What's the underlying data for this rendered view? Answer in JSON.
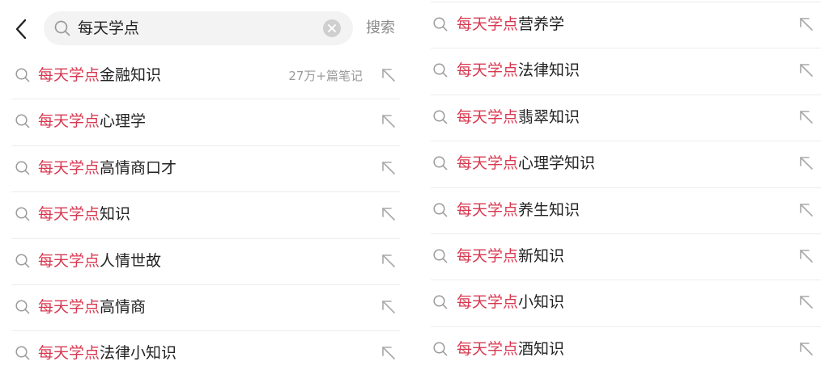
{
  "search": {
    "query": "每天学点",
    "button_label": "搜索"
  },
  "colors": {
    "highlight": "#d8374f",
    "muted": "#9a9a9a",
    "search_bg": "#f3f3f3"
  },
  "icons": {
    "back": "chevron-left-icon",
    "search": "search-icon",
    "clear": "clear-icon",
    "fill": "arrow-up-left-icon"
  },
  "left": {
    "suggestions": [
      {
        "highlight": "每天学点",
        "rest": "金融知识",
        "count": "27万+篇笔记"
      },
      {
        "highlight": "每天学点",
        "rest": "心理学"
      },
      {
        "highlight": "每天学点",
        "rest": "高情商口才"
      },
      {
        "highlight": "每天学点",
        "rest": "知识"
      },
      {
        "highlight": "每天学点",
        "rest": "人情世故"
      },
      {
        "highlight": "每天学点",
        "rest": "高情商"
      },
      {
        "highlight": "每天学点",
        "rest": "法律小知识"
      }
    ]
  },
  "right": {
    "suggestions": [
      {
        "highlight": "每天学点",
        "rest": "营养学"
      },
      {
        "highlight": "每天学点",
        "rest": "法律知识"
      },
      {
        "highlight": "每天学点",
        "rest": "翡翠知识"
      },
      {
        "highlight": "每天学点",
        "rest": "心理学知识"
      },
      {
        "highlight": "每天学点",
        "rest": "养生知识"
      },
      {
        "highlight": "每天学点",
        "rest": "新知识"
      },
      {
        "highlight": "每天学点",
        "rest": "小知识"
      },
      {
        "highlight": "每天学点",
        "rest": "酒知识"
      }
    ]
  }
}
